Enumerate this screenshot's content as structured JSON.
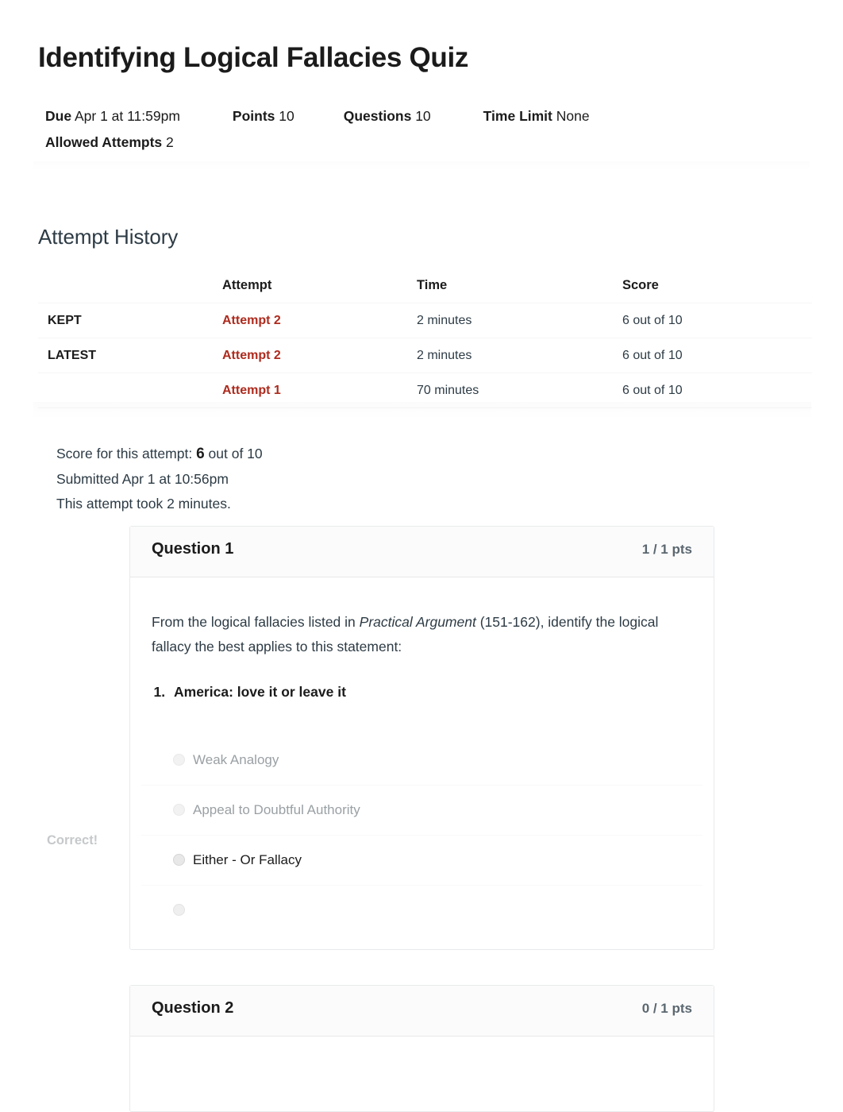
{
  "quiz": {
    "title": "Identifying Logical Fallacies Quiz",
    "meta": [
      {
        "label": "Due",
        "value": "Apr 1 at 11:59pm"
      },
      {
        "label": "Points",
        "value": "10"
      },
      {
        "label": "Questions",
        "value": "10"
      },
      {
        "label": "Time Limit",
        "value": "None"
      },
      {
        "label": "Allowed Attempts",
        "value": "2"
      }
    ]
  },
  "attempt_history": {
    "heading": "Attempt History",
    "columns": [
      "",
      "Attempt",
      "Time",
      "Score"
    ],
    "rows": [
      {
        "status": "KEPT",
        "attempt": "Attempt 2",
        "time": "2 minutes",
        "score": "6 out of 10"
      },
      {
        "status": "LATEST",
        "attempt": "Attempt 2",
        "time": "2 minutes",
        "score": "6 out of 10"
      },
      {
        "status": "",
        "attempt": "Attempt 1",
        "time": "70 minutes",
        "score": "6 out of 10"
      }
    ]
  },
  "attempt_summary": {
    "score_prefix": "Score for this attempt:",
    "score_value": "6",
    "score_suffix": "out of 10",
    "submitted": "Submitted Apr 1 at 10:56pm",
    "duration": "This attempt took 2 minutes."
  },
  "questions": [
    {
      "name": "Question 1",
      "points": "1 / 1 pts",
      "flag": "Correct!",
      "prompt_part1": "From the logical fallacies listed in ",
      "prompt_italic": "Practical Argument",
      "prompt_part2": " (151-162), identify the logical fallacy the best applies to this statement:",
      "statement": "America: love it or leave it",
      "answers": [
        {
          "text": "Weak Analogy",
          "selected": false,
          "blank": false
        },
        {
          "text": "Appeal to Doubtful Authority",
          "selected": false,
          "blank": false
        },
        {
          "text": "Either - Or Fallacy",
          "selected": true,
          "blank": false
        },
        {
          "text": "",
          "selected": false,
          "blank": true
        }
      ]
    },
    {
      "name": "Question 2",
      "points": "0 / 1 pts"
    }
  ],
  "colors": {
    "link_red": "#ad2b1e",
    "text": "#2d3b45",
    "muted": "#9aa0a4",
    "flag_grey": "#c6c9cb"
  }
}
